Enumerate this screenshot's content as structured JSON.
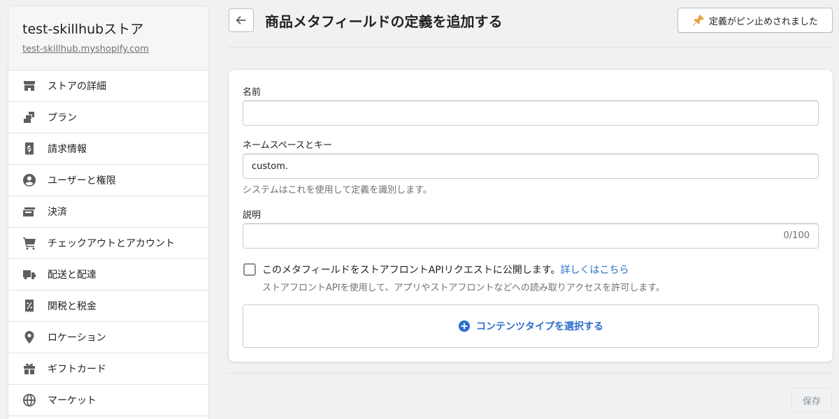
{
  "store": {
    "name": "test-skillhubストア",
    "url": "test-skillhub.myshopify.com"
  },
  "sidebar": {
    "items": [
      {
        "label": "ストアの詳細",
        "icon": "store-icon"
      },
      {
        "label": "プラン",
        "icon": "plan-icon"
      },
      {
        "label": "請求情報",
        "icon": "billing-icon"
      },
      {
        "label": "ユーザーと権限",
        "icon": "user-icon"
      },
      {
        "label": "決済",
        "icon": "payment-icon"
      },
      {
        "label": "チェックアウトとアカウント",
        "icon": "cart-icon"
      },
      {
        "label": "配送と配達",
        "icon": "truck-icon"
      },
      {
        "label": "関税と税金",
        "icon": "tax-icon"
      },
      {
        "label": "ロケーション",
        "icon": "location-icon"
      },
      {
        "label": "ギフトカード",
        "icon": "gift-icon"
      },
      {
        "label": "マーケット",
        "icon": "globe-icon"
      }
    ]
  },
  "header": {
    "title": "商品メタフィールドの定義を追加する",
    "pin_label": "定義がピン止めされました"
  },
  "form": {
    "name_label": "名前",
    "name_value": "",
    "namespace_label": "ネームスペースとキー",
    "namespace_value": "custom.",
    "namespace_help": "システムはこれを使用して定義を識別します。",
    "description_label": "説明",
    "description_value": "",
    "description_counter": "0/100",
    "storefront_label": "このメタフィールドをストアフロントAPIリクエストに公開します。",
    "storefront_link": "詳しくはこちら",
    "storefront_help": "ストアフロントAPIを使用して、アプリやストアフロントなどへの読み取りアクセスを許可します。",
    "storefront_checked": false,
    "content_type_label": "コンテンツタイプを選択する"
  },
  "footer": {
    "save_label": "保存"
  },
  "colors": {
    "link": "#2c6ecb",
    "pin": "#e8a23a",
    "background": "#f1f1f1"
  }
}
